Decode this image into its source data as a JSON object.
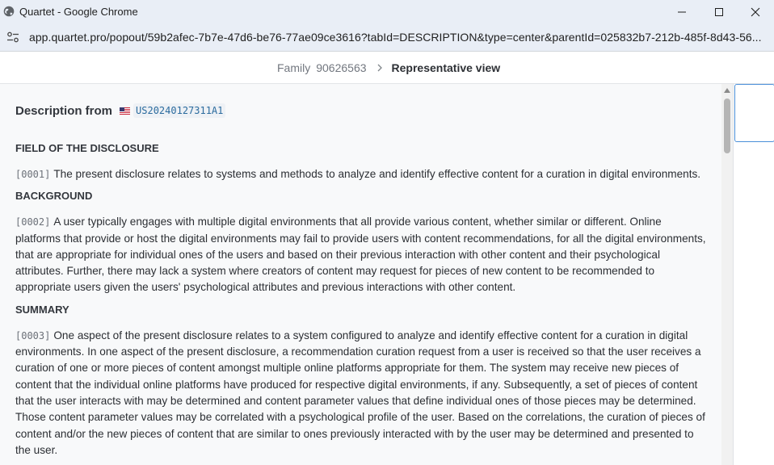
{
  "window": {
    "title": "Quartet - Google Chrome",
    "url": "app.quartet.pro/popout/59b2afec-7b7e-47d6-be76-77ae09ce3616?tabId=DESCRIPTION&type=center&parentId=025832b7-212b-485f-8d43-56..."
  },
  "breadcrumb": {
    "family_label": "Family",
    "family_id": "90626563",
    "current": "Representative view"
  },
  "description": {
    "title": "Description from",
    "publication": "US20240127311A1",
    "flag": "us-flag-icon"
  },
  "sections": [
    {
      "heading": "FIELD OF THE DISCLOSURE"
    },
    {
      "heading": "BACKGROUND"
    },
    {
      "heading": "SUMMARY"
    }
  ],
  "paragraphs": [
    {
      "num": "[0001]",
      "text": "The present disclosure relates to systems and methods to analyze and identify effective content for a curation in digital environments."
    },
    {
      "num": "[0002]",
      "text": "A user typically engages with multiple digital environments that all provide various content, whether similar or different. Online platforms that provide or host the digital environments may fail to provide users with content recommendations, for all the digital environments, that are appropriate for individual ones of the users and based on their previous interaction with other content and their psychological attributes. Further, there may lack a system where creators of content may request for pieces of new content to be recommended to appropriate users given the users' psychological attributes and previous interactions with other content."
    },
    {
      "num": "[0003]",
      "text": "One aspect of the present disclosure relates to a system configured to analyze and identify effective content for a curation in digital environments. In one aspect of the present disclosure, a recommendation curation request from a user is received so that the user receives a curation of one or more pieces of content amongst multiple online platforms appropriate for them. The system may receive new pieces of content that the individual online platforms have produced for respective digital environments, if any. Subsequently, a set of pieces of content that the user interacts with may be determined and content parameter values that define individual ones of those pieces may be determined. Those content parameter values may be correlated with a psychological profile of the user. Based on the correlations, the curation of pieces of content and/or the new pieces of content that are similar to ones previously interacted with by the user may be determined and presented to the user."
    }
  ]
}
